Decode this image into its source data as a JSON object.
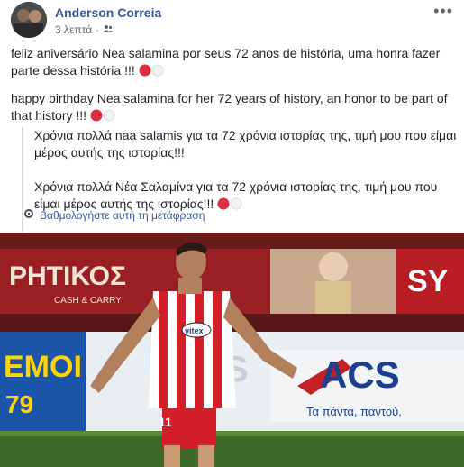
{
  "post": {
    "author_name": "Anderson Correia",
    "timestamp": "3 λεπτά",
    "audience_icon": "friends-icon",
    "more_icon": "more-options-icon",
    "text_pt": "feliz aniversário Nea salamina por seus 72 anos de história, uma honra fazer parte dessa história !!!",
    "text_en": "happy birthday Nea salamina for her 72 years of history, an honor to be part of that history !!!",
    "translation_1": "Χρόνια πολλά naa salamis για τα 72 χρόνια ιστορίας της, τιμή μου που είμαι μέρος αυτής της ιστορίας!!!",
    "translation_2": "Χρόνια πολλά Νέα Σαλαμίνα για τα 72 χρόνια ιστορίας της, τιμή μου που είμαι μέρος αυτής της ιστορίας!!!",
    "rate_translation": "Βαθμολογήστε αυτή τη μετάφραση",
    "emoji": [
      "red-circle-icon",
      "white-circle-icon"
    ]
  },
  "photo": {
    "banner_left": "ΡΗΤΙΚΟΣ",
    "banner_left_sub": "CASH & CARRY",
    "banner_mid_left": "ΕΜΟΙ",
    "banner_mid_left_num": "79",
    "banner_acs": "ACS",
    "banner_acs_sub": "Τα πάντα, παντού.",
    "banner_right": "SY",
    "shirt_sponsor": "vitex",
    "shirt_number": "11",
    "colors": {
      "shirt_red": "#d31f2a",
      "banner_red": "#b81d24",
      "pitch_green": "#3f6b2a"
    }
  }
}
